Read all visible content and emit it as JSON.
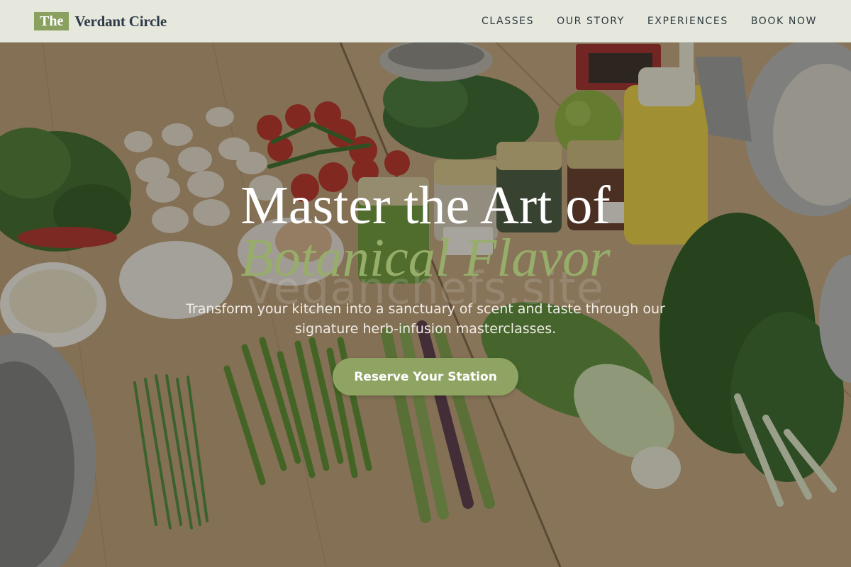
{
  "header": {
    "logo_badge": "The",
    "logo_name": "Verdant Circle",
    "nav": [
      {
        "label": "CLASSES"
      },
      {
        "label": "OUR STORY"
      },
      {
        "label": "EXPERIENCES"
      },
      {
        "label": "BOOK NOW"
      }
    ]
  },
  "hero": {
    "title_line1": "Master the Art of",
    "title_line2": "Botanical Flavor",
    "watermark": "veganchefs.site",
    "subtitle": "Transform your kitchen into a sanctuary of scent and taste through our signature herb-infusion masterclasses.",
    "cta_label": "Reserve Your Station"
  },
  "colors": {
    "accent_green": "#8fa462",
    "title_accent": "#97ad6a",
    "header_bg": "#ecf0e6",
    "logo_text": "#2d3a47"
  }
}
